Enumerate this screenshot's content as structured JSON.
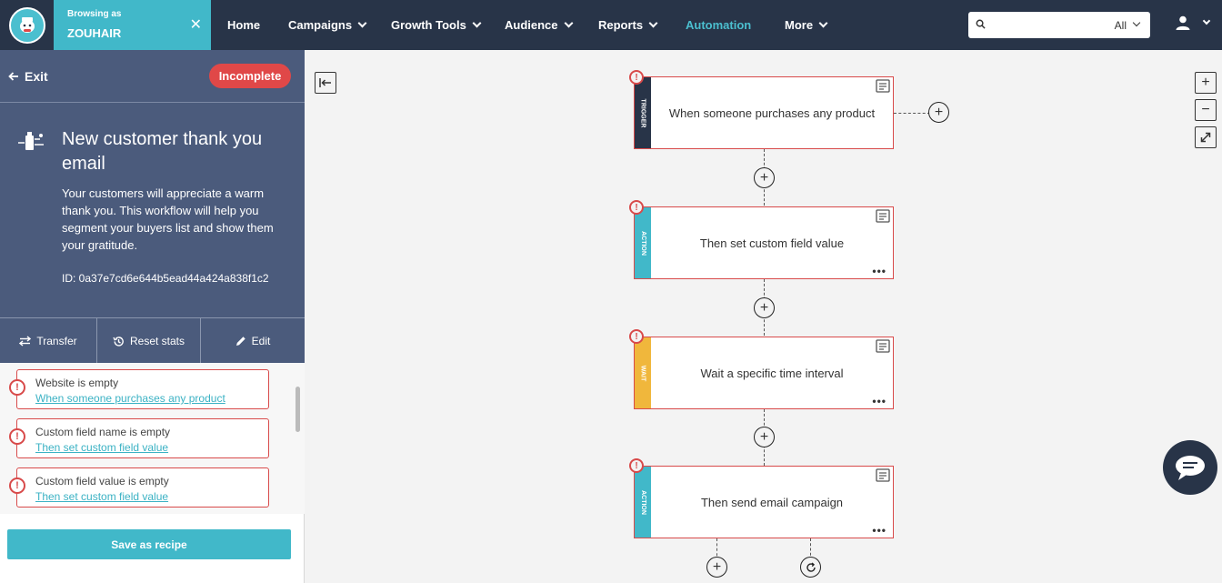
{
  "topbar": {
    "browsing_label": "Browsing as",
    "browsing_name": "ZOUHAIR",
    "nav": [
      {
        "label": "Home"
      },
      {
        "label": "Campaigns"
      },
      {
        "label": "Growth Tools"
      },
      {
        "label": "Audience"
      },
      {
        "label": "Reports"
      },
      {
        "label": "Automation"
      },
      {
        "label": "More"
      }
    ],
    "search": {
      "placeholder": "",
      "scope": "All"
    }
  },
  "sidebar": {
    "exit_label": "Exit",
    "status_badge": "Incomplete",
    "workflow_title": "New customer thank you email",
    "workflow_description": "Your customers will appreciate a warm thank you. This workflow will help you segment your buyers list and show them your gratitude.",
    "workflow_id": "ID: 0a37e7cd6e644b5ead44a424a838f1c2",
    "actions": [
      {
        "label": "Transfer"
      },
      {
        "label": "Reset stats"
      },
      {
        "label": "Edit"
      }
    ],
    "errors": [
      {
        "title": "Website is empty",
        "link": "When someone purchases any product"
      },
      {
        "title": "Custom field name is empty",
        "link": "Then set custom field value"
      },
      {
        "title": "Custom field value is empty",
        "link": "Then set custom field value"
      }
    ],
    "save_recipe_label": "Save as recipe"
  },
  "workflow": {
    "nodes": [
      {
        "type": "TRIGGER",
        "label": "When someone purchases any product",
        "color": "#283448"
      },
      {
        "type": "ACTION",
        "label": "Then set custom field value",
        "color": "#41b8c9"
      },
      {
        "type": "WAIT",
        "label": "Wait a specific time interval",
        "color": "#f0b73c"
      },
      {
        "type": "ACTION",
        "label": "Then send email campaign",
        "color": "#41b8c9"
      }
    ]
  },
  "colors": {
    "nav_bg": "#283448",
    "accent": "#41b8c9",
    "error": "#d84a4a",
    "sidebar_bg": "#4b5b7c"
  }
}
